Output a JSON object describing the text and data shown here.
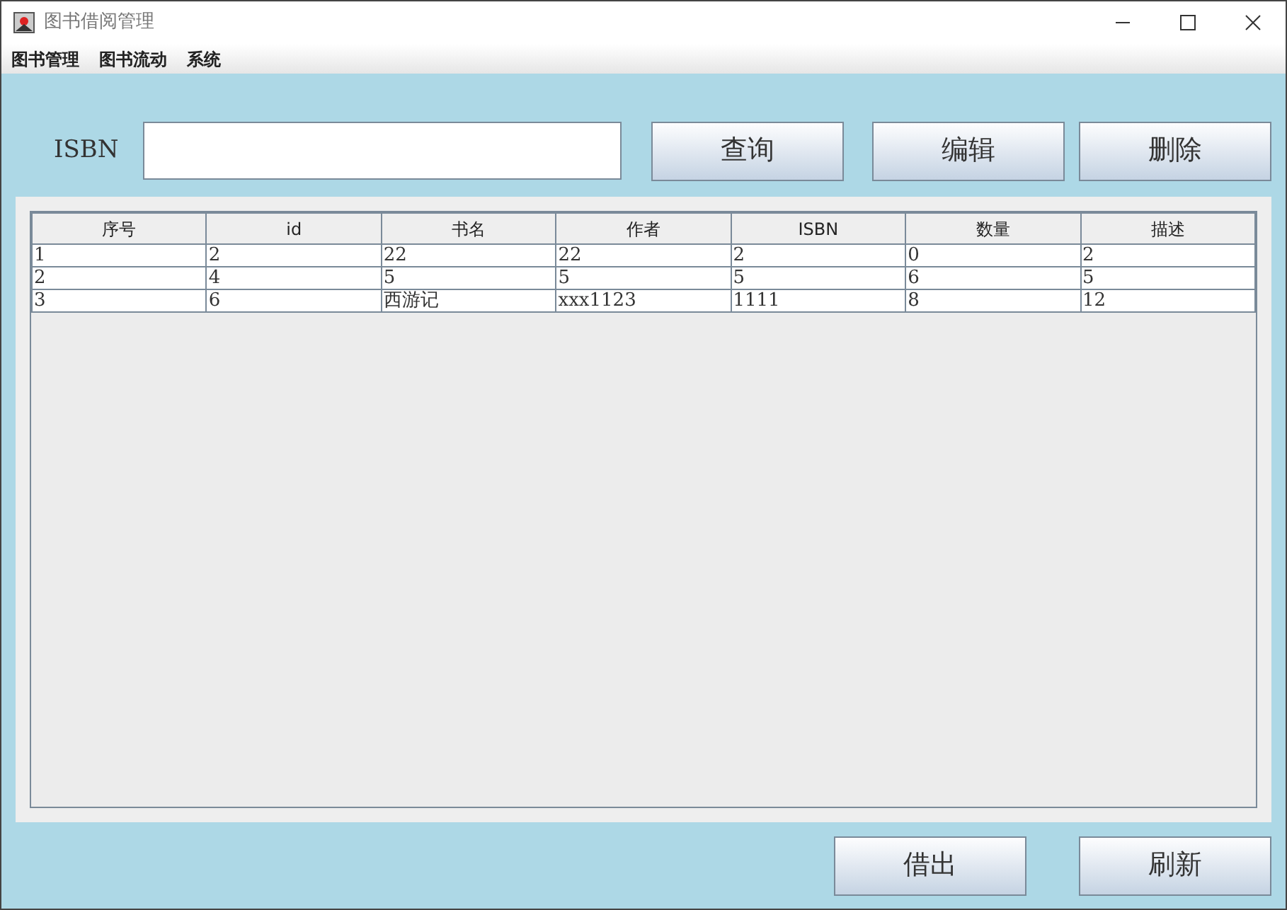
{
  "window": {
    "title": "图书借阅管理"
  },
  "menu": [
    "图书管理",
    "图书流动",
    "系统"
  ],
  "search": {
    "label": "ISBN"
  },
  "top_buttons": [
    "查询",
    "编辑",
    "删除"
  ],
  "table": {
    "columns": [
      "序号",
      "id",
      "书名",
      "作者",
      "ISBN",
      "数量",
      "描述"
    ],
    "rows": [
      [
        "1",
        "2",
        "22",
        "22",
        "2",
        "0",
        "2"
      ],
      [
        "2",
        "4",
        "5",
        "5",
        "5",
        "6",
        "5"
      ],
      [
        "3",
        "6",
        "西游记",
        "xxx1123",
        "1111",
        "8",
        "12"
      ]
    ]
  },
  "bottom_buttons": [
    "借出",
    "刷新"
  ]
}
